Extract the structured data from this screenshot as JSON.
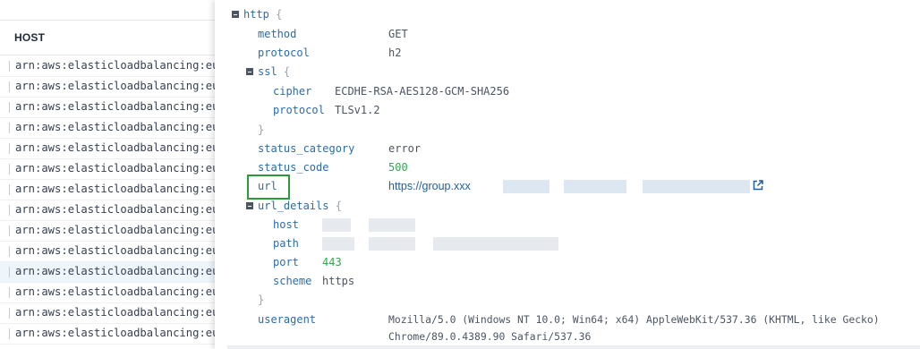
{
  "hosts": {
    "header": "HOST",
    "rows": [
      "arn:aws:elasticloadbalancing:eu-",
      "arn:aws:elasticloadbalancing:eu-",
      "arn:aws:elasticloadbalancing:eu-",
      "arn:aws:elasticloadbalancing:eu-",
      "arn:aws:elasticloadbalancing:eu-",
      "arn:aws:elasticloadbalancing:eu-",
      "arn:aws:elasticloadbalancing:eu-",
      "arn:aws:elasticloadbalancing:eu-",
      "arn:aws:elasticloadbalancing:eu-",
      "arn:aws:elasticloadbalancing:eu-",
      "arn:aws:elasticloadbalancing:eu-",
      "arn:aws:elasticloadbalancing:eu-",
      "arn:aws:elasticloadbalancing:eu-",
      "arn:aws:elasticloadbalancing:eu-"
    ],
    "selected_index": 10
  },
  "tree": {
    "http_key": "http",
    "open_brace": "{",
    "close_brace": "}",
    "method": {
      "key": "method",
      "value": "GET"
    },
    "protocol": {
      "key": "protocol",
      "value": "h2"
    },
    "ssl": {
      "key": "ssl",
      "cipher": {
        "key": "cipher",
        "value": "ECDHE-RSA-AES128-GCM-SHA256"
      },
      "protocol": {
        "key": "protocol",
        "value": "TLSv1.2"
      }
    },
    "status_category": {
      "key": "status_category",
      "value": "error"
    },
    "status_code": {
      "key": "status_code",
      "value": "500"
    },
    "url": {
      "key": "url",
      "value": "https://group.xxx"
    },
    "url_details": {
      "key": "url_details",
      "host": {
        "key": "host"
      },
      "path": {
        "key": "path"
      },
      "port": {
        "key": "port",
        "value": "443"
      },
      "scheme": {
        "key": "scheme",
        "value": "https"
      }
    },
    "useragent": {
      "key": "useragent",
      "line1": "Mozilla/5.0 (Windows NT 10.0; Win64; x64) AppleWebKit/537.36 (KHTML, like Gecko)",
      "line2": "Chrome/89.0.4389.90 Safari/537.36"
    }
  },
  "colors": {
    "key": "#2d6ca8",
    "number": "#2fa84f",
    "link": "#1f5f9e",
    "highlight": "#2e9b3a"
  }
}
